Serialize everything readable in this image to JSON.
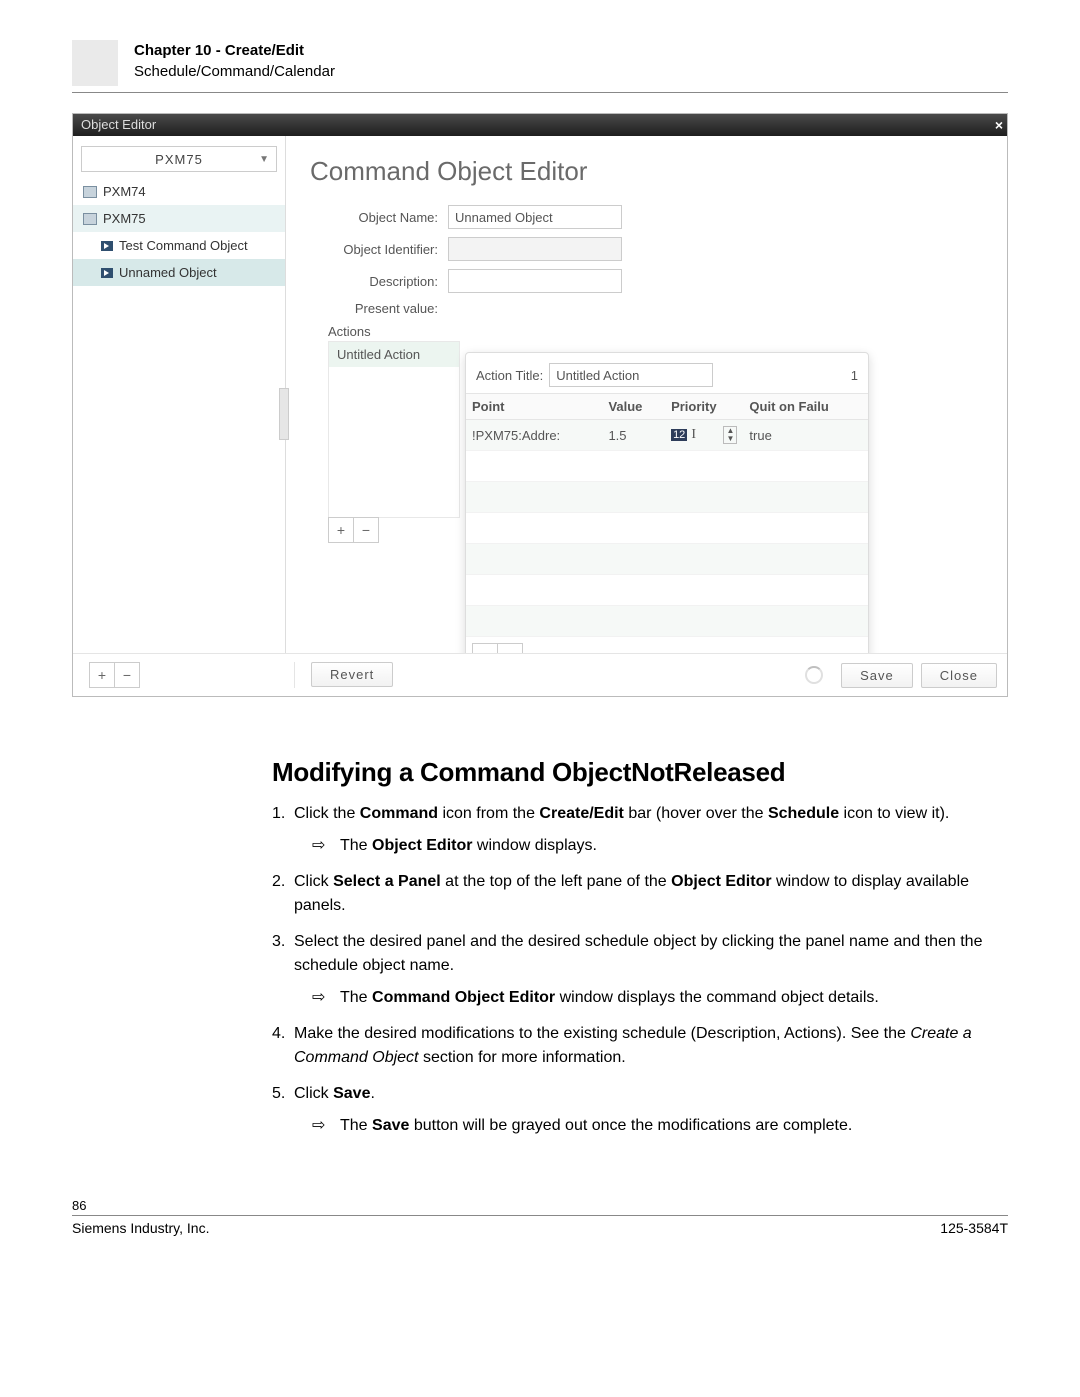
{
  "header": {
    "chapter": "Chapter 10 - Create/Edit",
    "breadcrumb": "Schedule/Command/Calendar"
  },
  "object_editor": {
    "title": "Object Editor",
    "panel_selector": "PXM75",
    "tree": {
      "pxm74": "PXM74",
      "pxm75": "PXM75",
      "test_cmd": "Test Command Object",
      "unnamed": "Unnamed Object"
    },
    "editor": {
      "title": "Command Object Editor",
      "labels": {
        "object_name": "Object Name:",
        "object_identifier": "Object Identifier:",
        "description": "Description:",
        "present_value": "Present value:",
        "actions": "Actions"
      },
      "object_name_value": "Unnamed Object",
      "action_item": "Untitled Action"
    },
    "popup": {
      "action_title_label": "Action Title:",
      "action_title_value": "Untitled Action",
      "count": "1",
      "columns": {
        "point": "Point",
        "value": "Value",
        "priority": "Priority",
        "quit": "Quit on Failu"
      },
      "row": {
        "point": "!PXM75:Addre:",
        "value": "1.5",
        "priority": "12",
        "quit": "true"
      }
    },
    "buttons": {
      "plus": "+",
      "minus": "−",
      "revert": "Revert",
      "save": "Save",
      "close": "Close"
    }
  },
  "doc": {
    "heading": "Modifying a Command ObjectNotReleased",
    "step1a": "Click the ",
    "step1b": " icon from the ",
    "step1c": " bar (hover over the ",
    "step1d": " icon to view it).",
    "bold_command": "Command",
    "bold_createedit": "Create/Edit",
    "bold_schedule": "Schedule",
    "res1a": "The ",
    "res1b": " window displays.",
    "bold_objed": "Object Editor",
    "step2a": "Click ",
    "step2b": " at the top of the left pane of the ",
    "step2c": " window to display available panels.",
    "bold_select_panel": "Select a Panel",
    "step3": "Select the desired panel and the desired schedule object by clicking the panel name and then the schedule object name.",
    "res3a": "The ",
    "res3b": " window displays the command object details.",
    "bold_coe": "Command Object Editor",
    "step4a": "Make the desired modifications to the existing schedule (Description, Actions). See the ",
    "step4b": " section for more information.",
    "italic_create": "Create a Command Object",
    "step5a": "Click ",
    "step5b": ".",
    "bold_save": "Save",
    "res5a": "The ",
    "res5b": " button will be grayed out once the modifications are complete."
  },
  "footer": {
    "page": "86",
    "left": "Siemens Industry, Inc.",
    "right": "125-3584T"
  }
}
